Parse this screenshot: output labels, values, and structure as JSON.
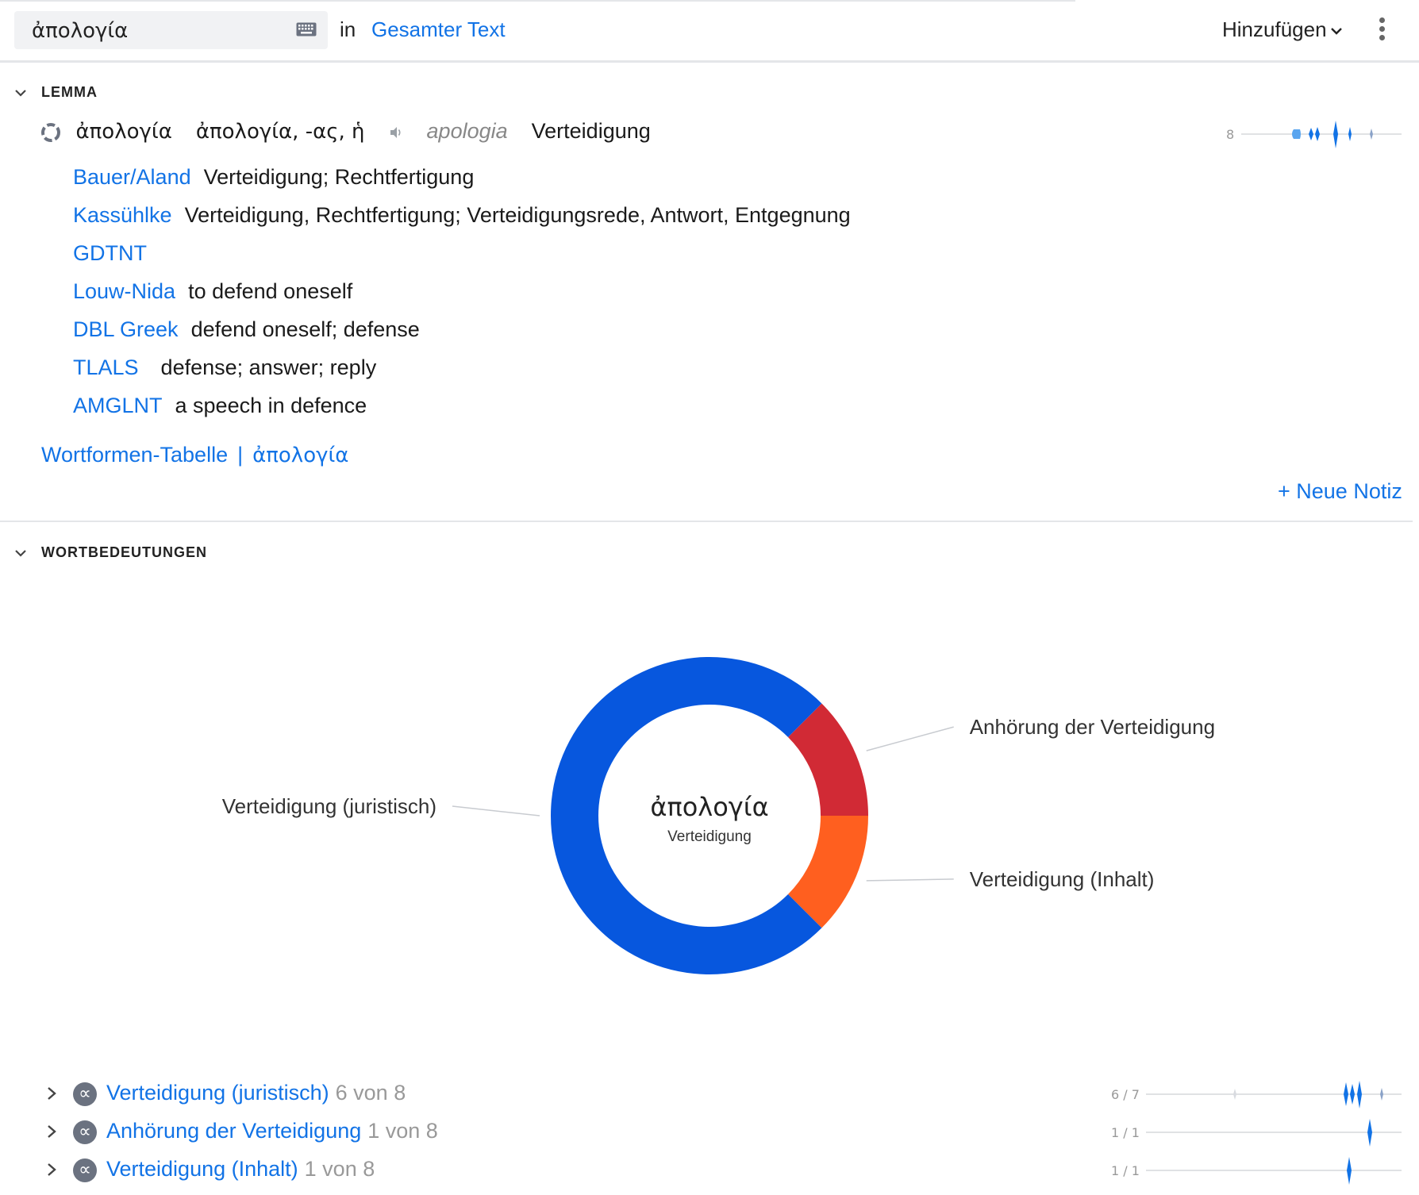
{
  "topbar": {
    "search_query": "ἀπολογία",
    "in_label": "in",
    "scope": "Gesamter Text",
    "add_label": "Hinzufügen",
    "icons": [
      "keyboard-icon",
      "chevron-down-icon",
      "more-vertical-icon"
    ]
  },
  "lemma_section": {
    "header": "LEMMA",
    "lemma": "ἀπολογία",
    "headword": "ἀπολογία, -ας, ἡ",
    "transliteration": "apologia",
    "gloss": "Verteidigung",
    "occurrence_count": "8",
    "dictionaries": [
      {
        "source": "Bauer/Aland",
        "definition": "Verteidigung; Rechtfertigung"
      },
      {
        "source": "Kassühlke",
        "definition": "Verteidigung, Rechtfertigung; Verteidigungsrede, Antwort, Entgegnung"
      },
      {
        "source": "GDTNT",
        "definition": ""
      },
      {
        "source": "Louw-Nida",
        "definition": "to defend oneself"
      },
      {
        "source": "DBL Greek",
        "definition": "defend oneself; defense"
      },
      {
        "source": "TLALS",
        "definition": "defense; answer; reply"
      },
      {
        "source": "AMGLNT",
        "definition": "a speech in defence"
      }
    ],
    "wordform_table": "Wortformen-Tabelle",
    "separator": "|",
    "wordform_lemma": "ἀπολογία",
    "new_note": "+ Neue Notiz"
  },
  "senses_section": {
    "header": "WORTBEDEUTUNGEN",
    "center_title": "ἀπολογία",
    "center_subtitle": "Verteidigung",
    "senses": [
      {
        "name": "Verteidigung (juristisch)",
        "count": "6 von 8",
        "spark": "6 / 7"
      },
      {
        "name": "Anhörung der Verteidigung",
        "count": "1 von 8",
        "spark": "1 / 1"
      },
      {
        "name": "Verteidigung (Inhalt)",
        "count": "1 von 8",
        "spark": "1 / 1"
      }
    ]
  },
  "chart_data": {
    "type": "pie",
    "title": "ἀπολογία",
    "subtitle": "Verteidigung",
    "categories": [
      "Verteidigung (juristisch)",
      "Anhörung der Verteidigung",
      "Verteidigung (Inhalt)"
    ],
    "values": [
      6,
      1,
      1
    ],
    "colors": [
      "#0757de",
      "#d12a35",
      "#ff5f1f"
    ]
  },
  "colors": {
    "accent": "#1273e6",
    "divider": "#e4e6e9",
    "muted": "#999999"
  }
}
